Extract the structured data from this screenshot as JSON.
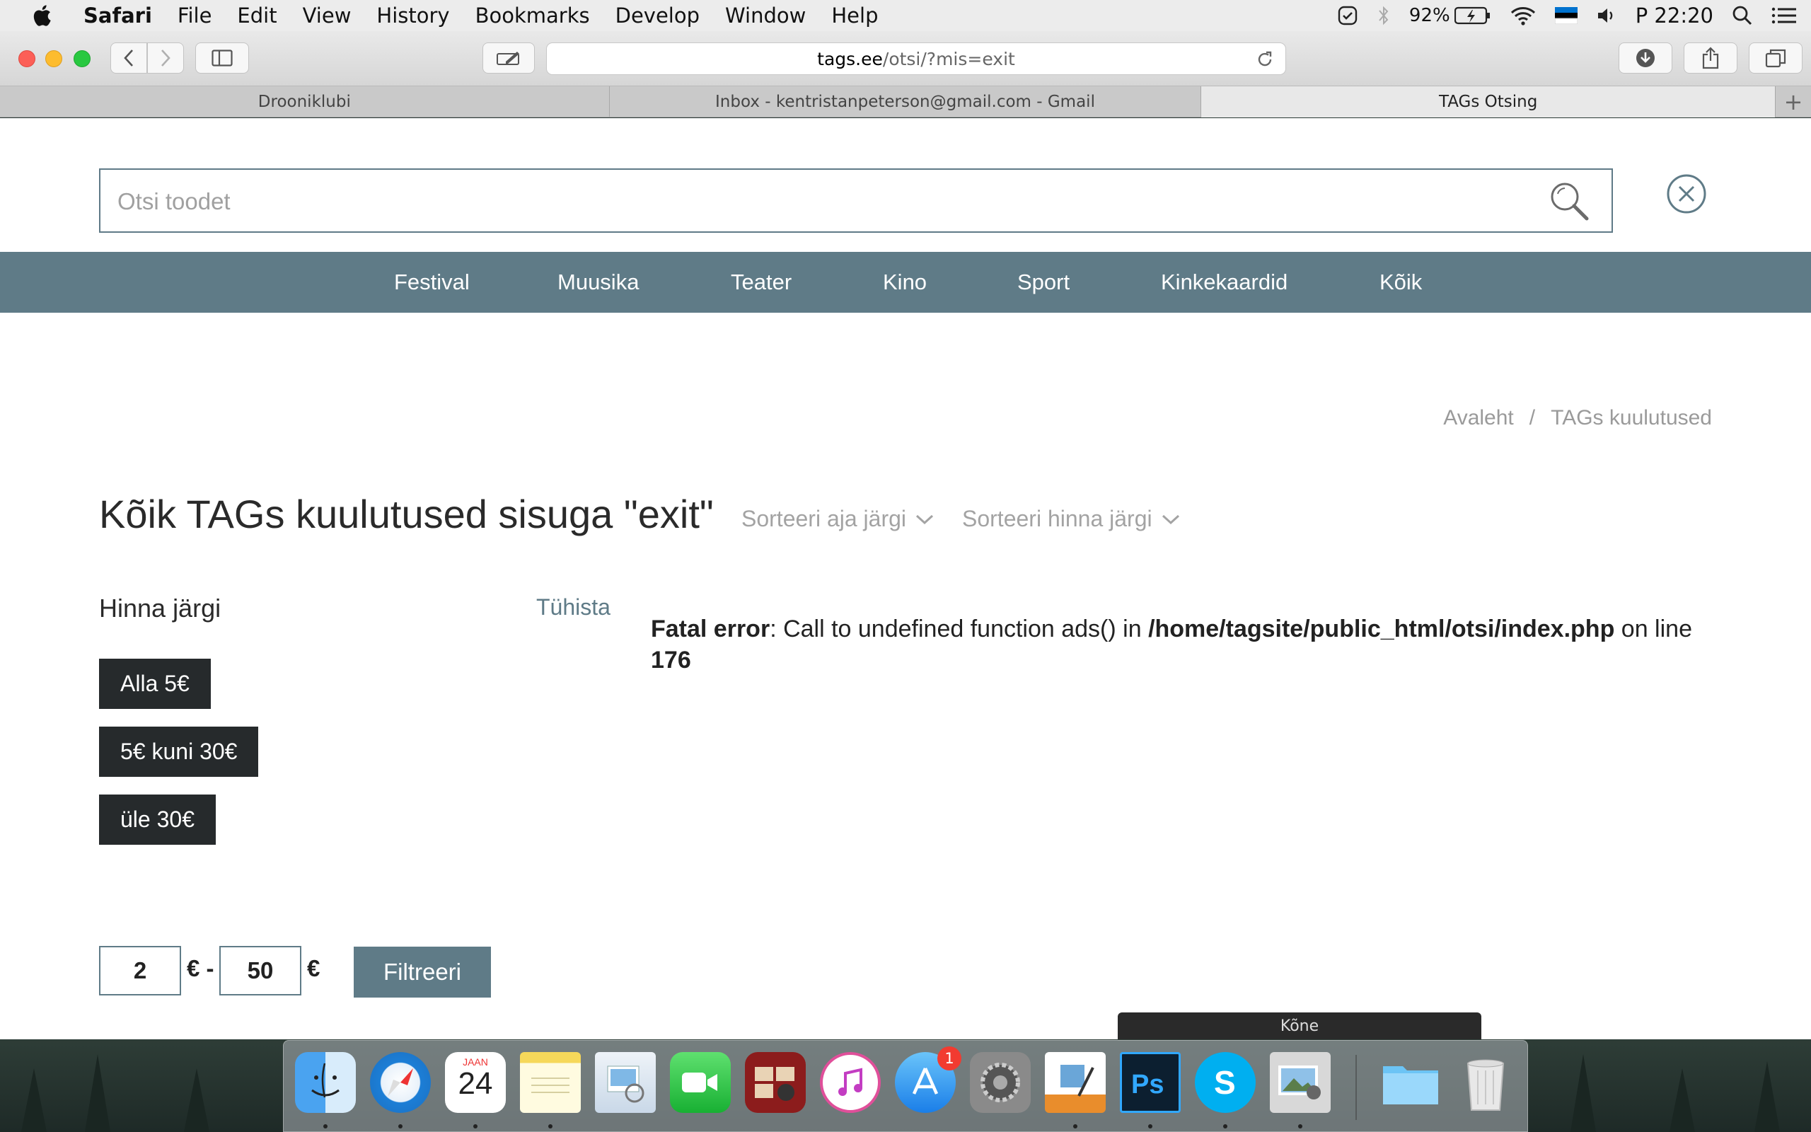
{
  "menubar": {
    "app_name": "Safari",
    "menus": [
      "File",
      "Edit",
      "View",
      "History",
      "Bookmarks",
      "Develop",
      "Window",
      "Help"
    ],
    "battery": "92%",
    "clock": "P 22:20"
  },
  "browser": {
    "url_host": "tags.ee",
    "url_path": "/otsi/?mis=exit",
    "tabs": [
      {
        "label": "Drooniklubi",
        "active": false
      },
      {
        "label": "Inbox - kentristanpeterson@gmail.com - Gmail",
        "active": false
      },
      {
        "label": "TAGs Otsing",
        "active": true
      }
    ],
    "new_tab": "+"
  },
  "search": {
    "placeholder": "Otsi toodet"
  },
  "nav": {
    "items": [
      "Festival",
      "Muusika",
      "Teater",
      "Kino",
      "Sport",
      "Kinkekaardid",
      "Kõik"
    ]
  },
  "breadcrumb": {
    "home": "Avaleht",
    "separator": "/",
    "current": "TAGs kuulutused"
  },
  "main": {
    "title": "Kõik TAGs kuulutused sisuga \"exit\"",
    "sort_time": "Sorteeri aja järgi",
    "sort_price": "Sorteeri hinna järgi"
  },
  "filter": {
    "title": "Hinna järgi",
    "reset": "Tühista",
    "price_buttons": [
      "Alla 5€",
      "5€ kuni 30€",
      "üle 30€"
    ],
    "min_value": "2",
    "max_value": "50",
    "range_sep": "€ -",
    "currency": "€",
    "submit": "Filtreeri"
  },
  "error": {
    "label": "Fatal error",
    "message": ": Call to undefined function ads() in ",
    "path": "/home/tagsite/public_html/otsi/index.php",
    "on_line": " on line ",
    "line": "176"
  },
  "dock": {
    "tooltip": "Kõne",
    "calendar_month": "JAAN",
    "calendar_day": "24",
    "appstore_badge": "1",
    "apps": [
      "finder-icon",
      "safari-icon",
      "calendar-icon",
      "notes-icon",
      "preview-icon",
      "facetime-icon",
      "photo-booth-icon",
      "itunes-icon",
      "app-store-icon",
      "system-preferences-icon",
      "pages-icon",
      "photoshop-icon",
      "skype-icon",
      "iphoto-icon",
      "folder-icon",
      "trash-icon"
    ]
  }
}
